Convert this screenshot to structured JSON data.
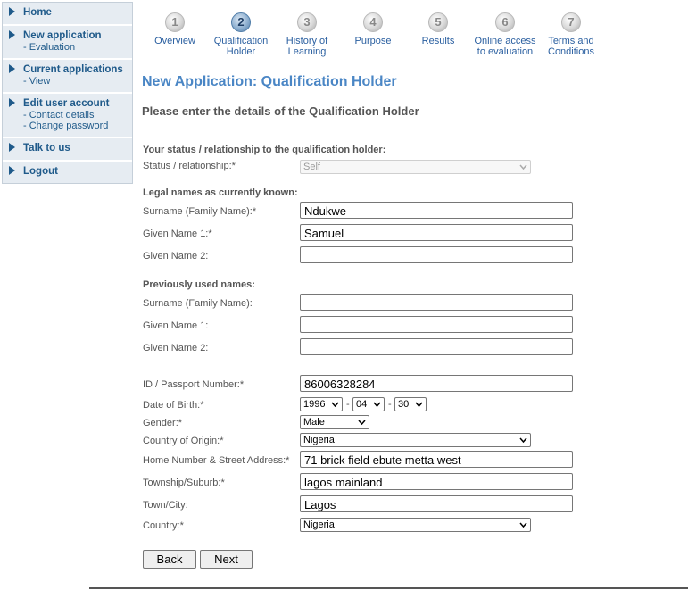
{
  "sidebar": {
    "items": [
      {
        "label": "Home",
        "subs": []
      },
      {
        "label": "New application",
        "subs": [
          "- Evaluation"
        ]
      },
      {
        "label": "Current applications",
        "subs": [
          "- View"
        ]
      },
      {
        "label": "Edit user account",
        "subs": [
          "- Contact details",
          "- Change password"
        ]
      },
      {
        "label": "Talk to us",
        "subs": []
      },
      {
        "label": "Logout",
        "subs": []
      }
    ]
  },
  "steps": [
    {
      "num": "1",
      "label1": "Overview",
      "label2": ""
    },
    {
      "num": "2",
      "label1": "Qualification",
      "label2": "Holder"
    },
    {
      "num": "3",
      "label1": "History of",
      "label2": "Learning"
    },
    {
      "num": "4",
      "label1": "Purpose",
      "label2": ""
    },
    {
      "num": "5",
      "label1": "Results",
      "label2": ""
    },
    {
      "num": "6",
      "label1": "Online access",
      "label2": "to evaluation"
    },
    {
      "num": "7",
      "label1": "Terms and",
      "label2": "Conditions"
    }
  ],
  "active_step": 2,
  "page_title": "New Application: Qualification Holder",
  "page_subtitle": "Please enter the details of the Qualification Holder",
  "status": {
    "heading": "Your status / relationship to the qualification holder:",
    "label": "Status / relationship:*",
    "value": "Self"
  },
  "legal_names": {
    "heading": "Legal names as currently known:",
    "surname_label": "Surname (Family Name):*",
    "surname_value": "Ndukwe",
    "given1_label": "Given Name 1:*",
    "given1_value": "Samuel",
    "given2_label": "Given Name 2:",
    "given2_value": ""
  },
  "previous_names": {
    "heading": "Previously used names:",
    "surname_label": "Surname (Family Name):",
    "given1_label": "Given Name 1:",
    "given2_label": "Given Name 2:"
  },
  "details": {
    "id_label": "ID / Passport Number:*",
    "id_value": "86006328284",
    "dob_label": "Date of Birth:*",
    "dob_year": "1996",
    "dob_month": "04",
    "dob_day": "30",
    "dob_sep": "-",
    "gender_label": "Gender:*",
    "gender_value": "Male",
    "origin_label": "Country of Origin:*",
    "origin_value": "Nigeria",
    "address_label": "Home Number & Street Address:*",
    "address_value": "71 brick field ebute metta west",
    "suburb_label": "Township/Suburb:*",
    "suburb_value": "lagos mainland",
    "city_label": "Town/City:",
    "city_value": "Lagos",
    "country_label": "Country:*",
    "country_value": "Nigeria"
  },
  "buttons": {
    "back": "Back",
    "next": "Next"
  },
  "colors": {
    "nav_bg": "#e6ecf2",
    "link": "#1f5a8a",
    "title": "#4a86c5"
  }
}
